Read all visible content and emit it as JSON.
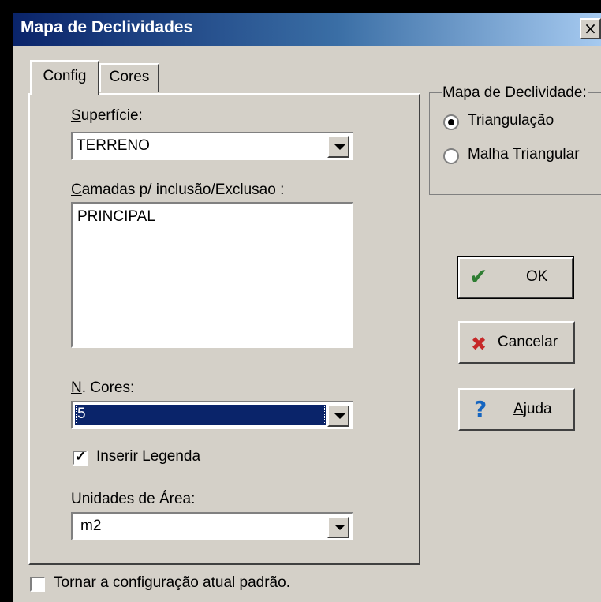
{
  "window": {
    "title": "Mapa de Declividades",
    "close_glyph": "×"
  },
  "tabs": [
    {
      "label": "Config",
      "active": true
    },
    {
      "label": "Cores",
      "active": false
    }
  ],
  "config": {
    "superficie": {
      "label_u": "S",
      "label_rest": "uperfície:",
      "value": "TERRENO"
    },
    "camadas": {
      "label_u": "C",
      "label_rest": "amadas p/ inclusão/Exclusao :",
      "items": [
        "PRINCIPAL"
      ]
    },
    "n_cores": {
      "label_u": "N",
      "label_rest": ". Cores:",
      "value": "5"
    },
    "inserir_legenda": {
      "label_u": "I",
      "label_rest": "nserir Legenda",
      "checked": true,
      "check_glyph": "✓"
    },
    "unidades": {
      "label": "Unidades de Área:",
      "value": "m2"
    }
  },
  "mapa_declividade": {
    "title": "Mapa de Declividade:",
    "options": [
      {
        "label": "Triangulação",
        "selected": true
      },
      {
        "label": "Malha Triangular",
        "selected": false
      }
    ]
  },
  "buttons": {
    "ok": {
      "label": "OK",
      "icon": "checkmark-icon",
      "glyph": "✔",
      "color": "#2e7d32"
    },
    "cancel": {
      "label": "Cancelar",
      "icon": "x-icon",
      "glyph": "✖",
      "color": "#c62828"
    },
    "help": {
      "label_u": "A",
      "label_rest": "juda",
      "icon": "question-icon",
      "glyph": "?",
      "color": "#1565c0"
    }
  },
  "footer": {
    "default_label": "Tornar a configuração atual padrão.",
    "checked": false
  },
  "colors": {
    "titlebar_start": "#0a246a",
    "titlebar_end": "#a6caf0",
    "face": "#d4d0c8",
    "selection": "#0a246a"
  }
}
